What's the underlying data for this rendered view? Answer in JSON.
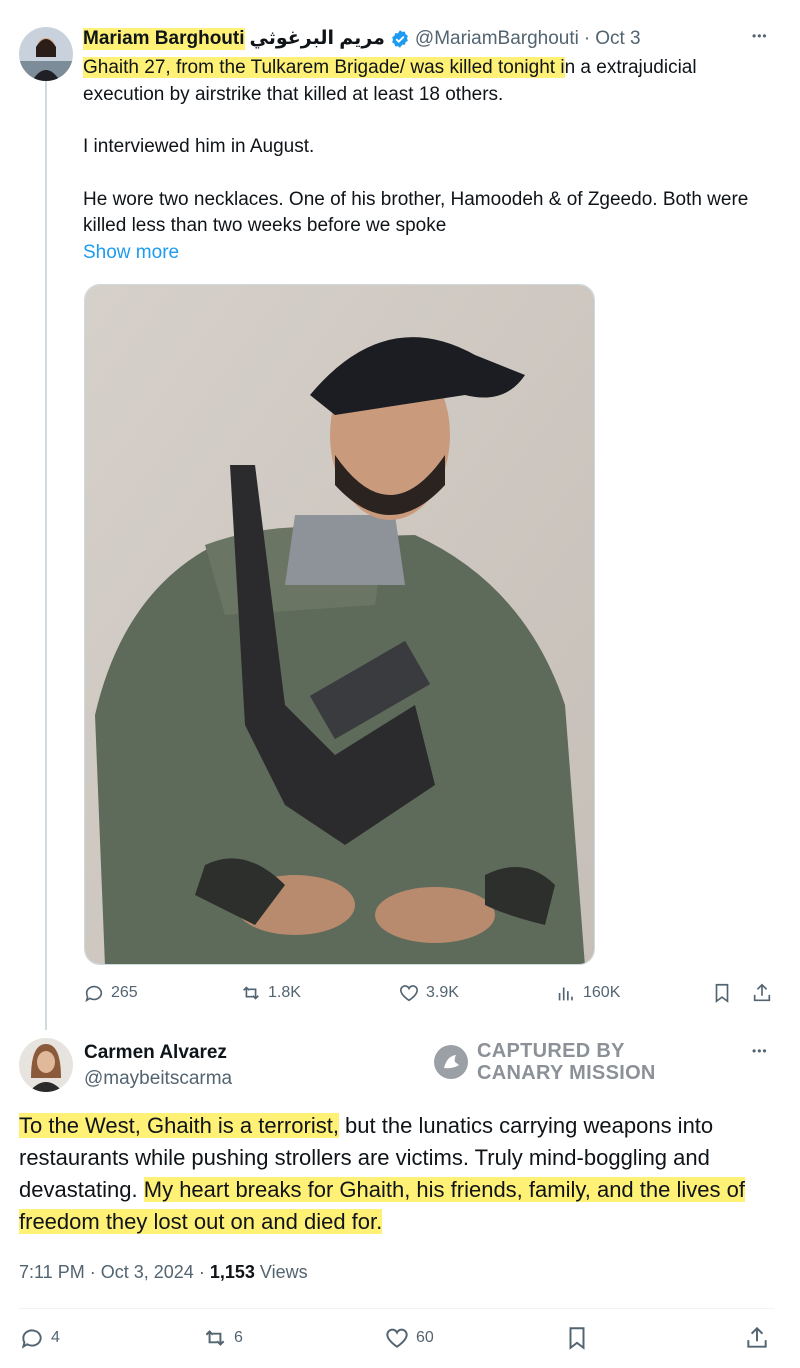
{
  "tweet1": {
    "display_name": "Mariam Barghouti",
    "display_name_arabic": "مريم البرغوثي",
    "handle": "@MariamBarghouti",
    "separator": "·",
    "date": "Oct 3",
    "more_glyph": "•••",
    "text_highlighted": "Ghaith 27, from the Tulkarem Brigade/ was killed tonight i",
    "text_rest": "n a extrajudicial execution by airstrike that killed at least 18 others.",
    "paragraph2": "I interviewed him in August.",
    "paragraph3": "He wore two necklaces. One of his brother, Hamoodeh & of Zgeedo. Both were killed less than two weeks before we spoke",
    "show_more": "Show more",
    "replies": "265",
    "reposts": "1.8K",
    "likes": "3.9K",
    "views": "160K"
  },
  "tweet2": {
    "display_name": "Carmen Alvarez",
    "handle": "@maybeitscarma",
    "more_glyph": "•••",
    "text_hl1": "To the West, Ghaith is a terrorist,",
    "text_mid": " but the lunatics carrying weapons into restaurants while pushing strollers are victims. Truly mind-boggling and devastating. ",
    "text_hl2": "My heart breaks for Ghaith, his friends, family, and the lives of freedom they lost out on and died for.",
    "time": "7:11 PM",
    "dot": "·",
    "date": "Oct 3, 2024",
    "views_count": "1,153",
    "views_label": "Views",
    "replies": "4",
    "reposts": "6",
    "likes": "60"
  },
  "watermark": {
    "line1": "CAPTURED BY",
    "line2": "CANARY MISSION"
  },
  "colors": {
    "highlight": "#fff176",
    "link": "#1d9bf0",
    "verified": "#1d9bf0",
    "muted": "#536471"
  }
}
